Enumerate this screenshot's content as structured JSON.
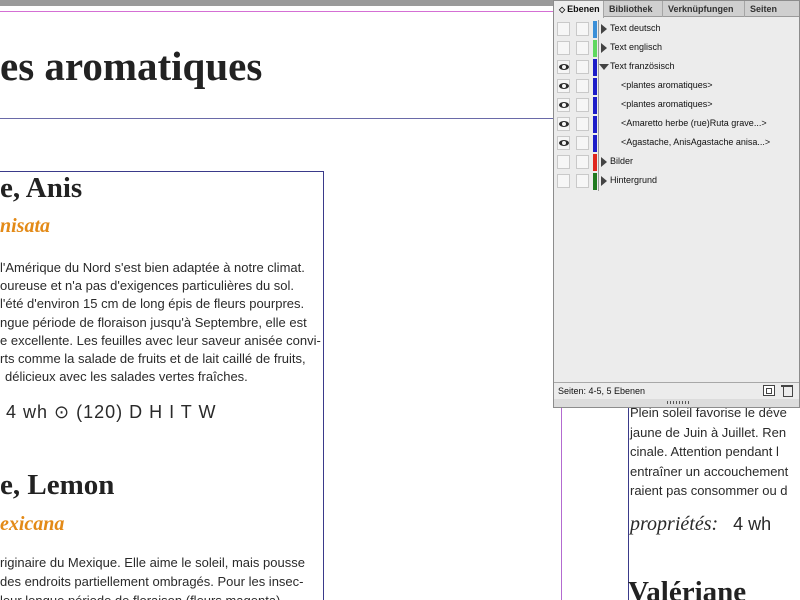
{
  "document": {
    "page_title": "es aromatiques",
    "section1": {
      "name": "e, Anis",
      "latin": "nisata",
      "lines": [
        "l'Amérique du Nord s'est bien adaptée à notre climat.",
        "oureuse et n'a pas d'exigences particulières du sol.",
        "l'été d'environ 15 cm de long épis de fleurs pourpres.",
        "ngue période de floraison jusqu'à Septembre, elle est",
        "e excellente. Les feuilles avec leur saveur anisée convi-",
        "rts comme la salade de fruits et de lait caillé de fruits,",
        "délicieux avec les salades vertes fraîches."
      ],
      "symbols": "4  wh  ⊙  (120)  D  H  I  T  W"
    },
    "section2": {
      "name": "e, Lemon",
      "latin": "exicana",
      "lines": [
        "riginaire du Mexique. Elle aime le soleil, mais pousse",
        "des endroits partiellement ombragés. Pour les insec-",
        "leur longue période de floraison (fleurs magenta)"
      ]
    },
    "right_column": {
      "lines": [
        "Plein soleil favorise le déve",
        "jaune de Juin à Juillet. Ren",
        "cinale. Attention pendant l",
        "entraîner un accouchement",
        "raient pas consommer ou d"
      ],
      "props_label": "propriétés:",
      "props_symbols": "4 wh",
      "next_heading": "Valériane"
    }
  },
  "layers_panel": {
    "tabs": [
      {
        "label": "Ebenen",
        "active": true
      },
      {
        "label": "Bibliothek",
        "active": false
      },
      {
        "label": "Verknüpfungen",
        "active": false
      },
      {
        "label": "Seiten",
        "active": false
      }
    ],
    "layers": [
      {
        "label": "Text deutsch",
        "visible": false,
        "color": "#3a8fd8",
        "expanded": false,
        "child": false
      },
      {
        "label": "Text englisch",
        "visible": false,
        "color": "#5fd85f",
        "expanded": false,
        "child": false
      },
      {
        "label": "Text französisch",
        "visible": true,
        "color": "#1b1bc8",
        "expanded": true,
        "child": false
      },
      {
        "label": "<plantes aromatiques>",
        "visible": true,
        "color": "#1b1bc8",
        "expanded": false,
        "child": true
      },
      {
        "label": "<plantes aromatiques>",
        "visible": true,
        "color": "#1b1bc8",
        "expanded": false,
        "child": true
      },
      {
        "label": "<Amaretto herbe (rue)Ruta grave...>",
        "visible": true,
        "color": "#1b1bc8",
        "expanded": false,
        "child": true
      },
      {
        "label": "<Agastache, AnisAgastache anisa...>",
        "visible": true,
        "color": "#1b1bc8",
        "expanded": false,
        "child": true
      },
      {
        "label": "Bilder",
        "visible": false,
        "color": "#e0261e",
        "expanded": false,
        "child": false
      },
      {
        "label": "Hintergrund",
        "visible": false,
        "color": "#1f7a1f",
        "expanded": false,
        "child": false
      }
    ],
    "status": "Seiten: 4-5, 5 Ebenen"
  }
}
